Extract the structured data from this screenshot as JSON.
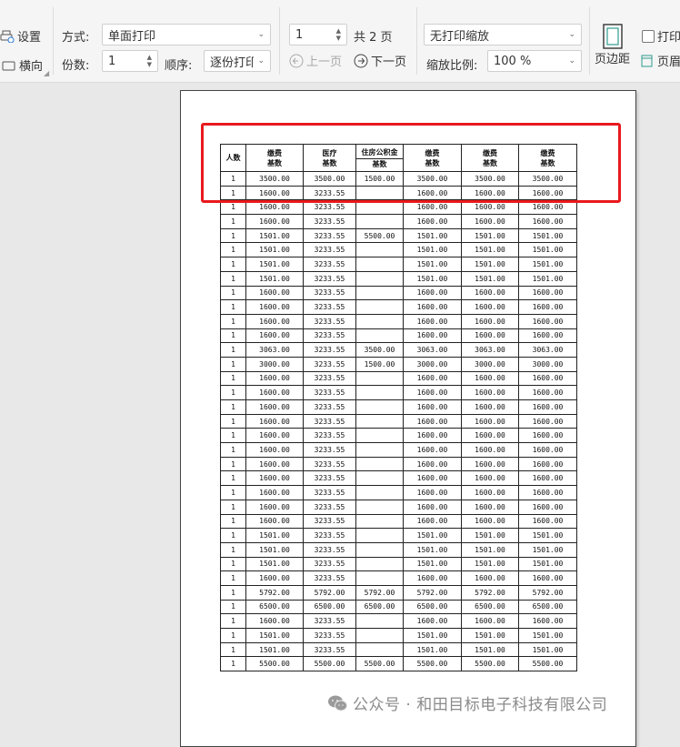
{
  "toolbar": {
    "settings_label": "设置",
    "landscape_label": "横向",
    "mode_label": "方式:",
    "mode_value": "单面打印",
    "copies_label": "份数:",
    "copies_value": "1",
    "order_label": "顺序:",
    "order_value": "逐份打印",
    "page_value": "1",
    "page_total": "共 2 页",
    "prev_page": "上一页",
    "next_page": "下一页",
    "scale_mode": "无打印缩放",
    "zoom_label": "缩放比例:",
    "zoom_value": "100 %",
    "margins_label": "页边距",
    "print_label": "打印",
    "header_label": "页眉"
  },
  "table": {
    "headers": {
      "count": "人数",
      "base1_top": "缴费",
      "base1_bottom": "基数",
      "medical_top": "医疗",
      "medical_bottom": "基数",
      "housing_top": "住房公积金",
      "housing_bottom": "基数",
      "base2_top": "缴费",
      "base2_bottom": "基数",
      "base3_top": "缴费",
      "base3_bottom": "基数",
      "base4_top": "缴费",
      "base4_bottom": "基数"
    },
    "rows": [
      [
        "1",
        "3500.00",
        "3500.00",
        "1500.00",
        "3500.00",
        "3500.00",
        "3500.00"
      ],
      [
        "1",
        "1600.00",
        "3233.55",
        "",
        "1600.00",
        "1600.00",
        "1600.00"
      ],
      [
        "1",
        "1600.00",
        "3233.55",
        "",
        "1600.00",
        "1600.00",
        "1600.00"
      ],
      [
        "1",
        "1600.00",
        "3233.55",
        "",
        "1600.00",
        "1600.00",
        "1600.00"
      ],
      [
        "1",
        "1501.00",
        "3233.55",
        "5500.00",
        "1501.00",
        "1501.00",
        "1501.00"
      ],
      [
        "1",
        "1501.00",
        "3233.55",
        "",
        "1501.00",
        "1501.00",
        "1501.00"
      ],
      [
        "1",
        "1501.00",
        "3233.55",
        "",
        "1501.00",
        "1501.00",
        "1501.00"
      ],
      [
        "1",
        "1501.00",
        "3233.55",
        "",
        "1501.00",
        "1501.00",
        "1501.00"
      ],
      [
        "1",
        "1600.00",
        "3233.55",
        "",
        "1600.00",
        "1600.00",
        "1600.00"
      ],
      [
        "1",
        "1600.00",
        "3233.55",
        "",
        "1600.00",
        "1600.00",
        "1600.00"
      ],
      [
        "1",
        "1600.00",
        "3233.55",
        "",
        "1600.00",
        "1600.00",
        "1600.00"
      ],
      [
        "1",
        "1600.00",
        "3233.55",
        "",
        "1600.00",
        "1600.00",
        "1600.00"
      ],
      [
        "1",
        "3063.00",
        "3233.55",
        "3500.00",
        "3063.00",
        "3063.00",
        "3063.00"
      ],
      [
        "1",
        "3000.00",
        "3233.55",
        "1500.00",
        "3000.00",
        "3000.00",
        "3000.00"
      ],
      [
        "1",
        "1600.00",
        "3233.55",
        "",
        "1600.00",
        "1600.00",
        "1600.00"
      ],
      [
        "1",
        "1600.00",
        "3233.55",
        "",
        "1600.00",
        "1600.00",
        "1600.00"
      ],
      [
        "1",
        "1600.00",
        "3233.55",
        "",
        "1600.00",
        "1600.00",
        "1600.00"
      ],
      [
        "1",
        "1600.00",
        "3233.55",
        "",
        "1600.00",
        "1600.00",
        "1600.00"
      ],
      [
        "1",
        "1600.00",
        "3233.55",
        "",
        "1600.00",
        "1600.00",
        "1600.00"
      ],
      [
        "1",
        "1600.00",
        "3233.55",
        "",
        "1600.00",
        "1600.00",
        "1600.00"
      ],
      [
        "1",
        "1600.00",
        "3233.55",
        "",
        "1600.00",
        "1600.00",
        "1600.00"
      ],
      [
        "1",
        "1600.00",
        "3233.55",
        "",
        "1600.00",
        "1600.00",
        "1600.00"
      ],
      [
        "1",
        "1600.00",
        "3233.55",
        "",
        "1600.00",
        "1600.00",
        "1600.00"
      ],
      [
        "1",
        "1600.00",
        "3233.55",
        "",
        "1600.00",
        "1600.00",
        "1600.00"
      ],
      [
        "1",
        "1600.00",
        "3233.55",
        "",
        "1600.00",
        "1600.00",
        "1600.00"
      ],
      [
        "1",
        "1501.00",
        "3233.55",
        "",
        "1501.00",
        "1501.00",
        "1501.00"
      ],
      [
        "1",
        "1501.00",
        "3233.55",
        "",
        "1501.00",
        "1501.00",
        "1501.00"
      ],
      [
        "1",
        "1501.00",
        "3233.55",
        "",
        "1501.00",
        "1501.00",
        "1501.00"
      ],
      [
        "1",
        "1600.00",
        "3233.55",
        "",
        "1600.00",
        "1600.00",
        "1600.00"
      ],
      [
        "1",
        "5792.00",
        "5792.00",
        "5792.00",
        "5792.00",
        "5792.00",
        "5792.00"
      ],
      [
        "1",
        "6500.00",
        "6500.00",
        "6500.00",
        "6500.00",
        "6500.00",
        "6500.00"
      ],
      [
        "1",
        "1600.00",
        "3233.55",
        "",
        "1600.00",
        "1600.00",
        "1600.00"
      ],
      [
        "1",
        "1501.00",
        "3233.55",
        "",
        "1501.00",
        "1501.00",
        "1501.00"
      ],
      [
        "1",
        "1501.00",
        "3233.55",
        "",
        "1501.00",
        "1501.00",
        "1501.00"
      ],
      [
        "1",
        "5500.00",
        "5500.00",
        "5500.00",
        "5500.00",
        "5500.00",
        "5500.00"
      ]
    ]
  },
  "watermark": "公众号 · 和田目标电子科技有限公司",
  "colors": {
    "highlight": "#e8191d",
    "toolbar_bg": "#f5f5f5",
    "preview_bg": "#e8e8e8"
  }
}
